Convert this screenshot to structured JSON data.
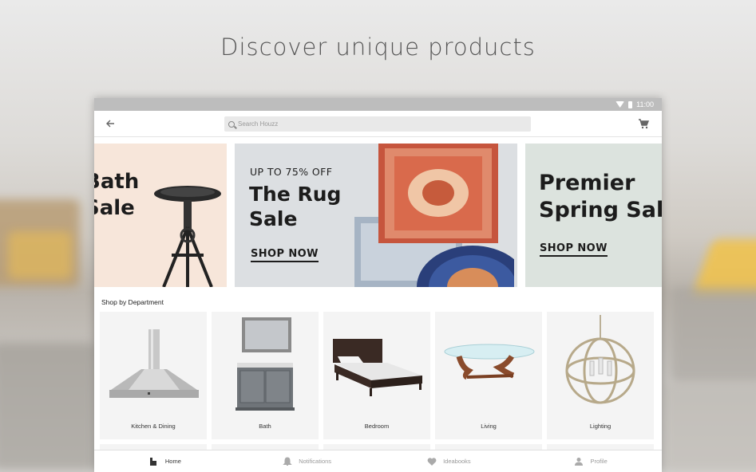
{
  "headline": "Discover unique products",
  "status_bar": {
    "time": "11:00"
  },
  "appbar": {
    "search_placeholder": "Search Houzz"
  },
  "banners": [
    {
      "title_line1": "Bath",
      "title_line2": "Sale"
    },
    {
      "eyebrow": "UP TO 75% OFF",
      "title_line1": "The Rug",
      "title_line2": "Sale",
      "cta": "SHOP NOW"
    },
    {
      "title_line1": "Premier",
      "title_line2": "Spring Sale",
      "cta": "SHOP NOW"
    }
  ],
  "departments": {
    "title": "Shop by Department",
    "items": [
      {
        "label": "Kitchen & Dining",
        "icon": "range-hood-icon"
      },
      {
        "label": "Bath",
        "icon": "vanity-icon"
      },
      {
        "label": "Bedroom",
        "icon": "bed-icon"
      },
      {
        "label": "Living",
        "icon": "coffee-table-icon"
      },
      {
        "label": "Lighting",
        "icon": "chandelier-icon"
      }
    ]
  },
  "bottom_nav": [
    {
      "label": "Home",
      "icon": "home-icon",
      "active": true
    },
    {
      "label": "Notifications",
      "icon": "bell-icon",
      "active": false
    },
    {
      "label": "Ideabooks",
      "icon": "heart-icon",
      "active": false
    },
    {
      "label": "Profile",
      "icon": "person-icon",
      "active": false
    }
  ],
  "colors": {
    "status_bar": "#bdbdbd",
    "bath_banner_bg": "#f7e6da",
    "rug_banner_bg": "#dcdfe2",
    "spring_banner_bg": "#dce3de",
    "card_bg": "#f4f4f4"
  }
}
